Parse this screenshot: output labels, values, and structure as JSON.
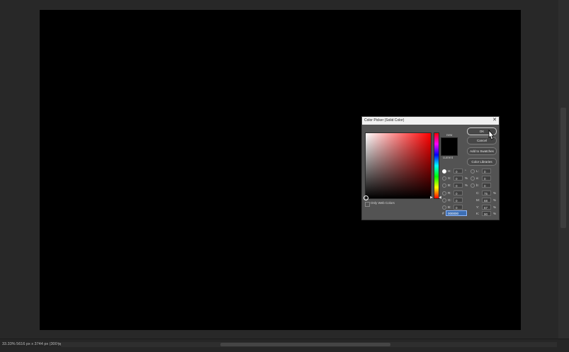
{
  "status_bar": {
    "info": "33.33%  5616 px x 3744 px (300 ppi)",
    "chevron": "›"
  },
  "dialog": {
    "title": "Color Picker (Solid Color)",
    "close": "✕",
    "preview": {
      "new_label": "new",
      "current_label": "current",
      "color": "#000000"
    },
    "buttons": {
      "ok": "OK",
      "cancel": "Cancel",
      "add_to_swatches": "Add to Swatches",
      "color_libraries": "Color Libraries"
    },
    "hsb": [
      {
        "label": "H:",
        "value": "0",
        "unit": "°",
        "checked": true
      },
      {
        "label": "S:",
        "value": "0",
        "unit": "%",
        "checked": false
      },
      {
        "label": "B:",
        "value": "0",
        "unit": "%",
        "checked": false
      }
    ],
    "rgb": [
      {
        "label": "R:",
        "value": "0"
      },
      {
        "label": "G:",
        "value": "0"
      },
      {
        "label": "B:",
        "value": "0"
      }
    ],
    "lab": [
      {
        "label": "L:",
        "value": "0"
      },
      {
        "label": "a:",
        "value": "0"
      },
      {
        "label": "b:",
        "value": "0"
      }
    ],
    "cmyk": [
      {
        "label": "C:",
        "value": "75",
        "unit": "%"
      },
      {
        "label": "M:",
        "value": "68",
        "unit": "%"
      },
      {
        "label": "Y:",
        "value": "67",
        "unit": "%"
      },
      {
        "label": "K:",
        "value": "90",
        "unit": "%"
      }
    ],
    "hex": {
      "label": "#",
      "value": "000000"
    },
    "only_web_colors": "Only Web Colors"
  }
}
